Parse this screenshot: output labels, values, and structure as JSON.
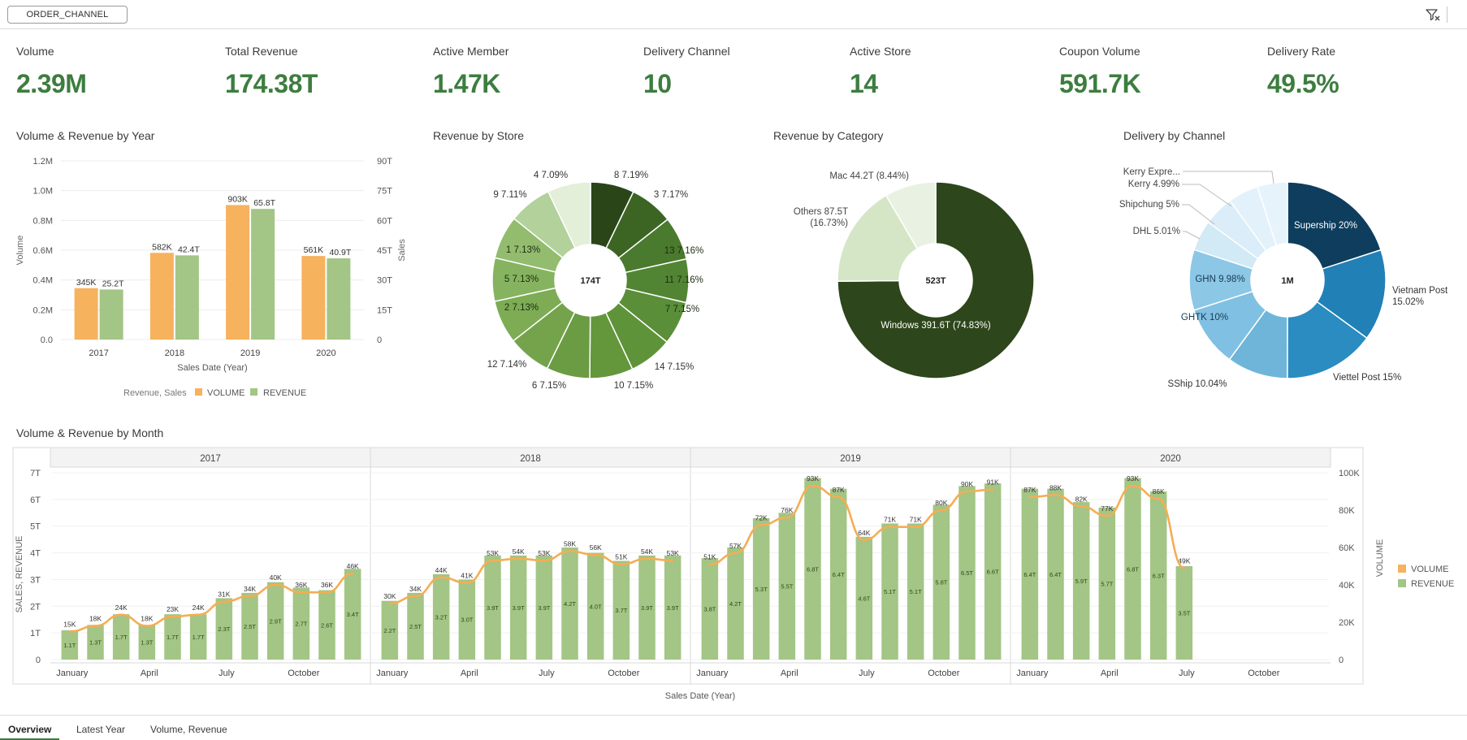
{
  "filter": {
    "label": "ORDER_CHANNEL"
  },
  "toolbar": {
    "filter_icon": "filter-icon"
  },
  "kpis": [
    {
      "label": "Volume",
      "value": "2.39M"
    },
    {
      "label": "Total Revenue",
      "value": "174.38T"
    },
    {
      "label": "Active Member",
      "value": "1.47K"
    },
    {
      "label": "Delivery Channel",
      "value": "10"
    },
    {
      "label": "Active Store",
      "value": "14"
    },
    {
      "label": "Coupon Volume",
      "value": "591.7K"
    },
    {
      "label": "Delivery Rate",
      "value": "49.5%"
    }
  ],
  "titles": {
    "year_chart": "Volume & Revenue by Year",
    "store_chart": "Revenue by Store",
    "category_chart": "Revenue by Category",
    "delivery_chart": "Delivery by Channel",
    "month_chart": "Volume & Revenue by Month"
  },
  "tabs": [
    {
      "label": "Overview",
      "active": true
    },
    {
      "label": "Latest Year",
      "active": false
    },
    {
      "label": "Volume, Revenue",
      "active": false
    }
  ],
  "colors": {
    "volume": "#f6b25d",
    "revenue": "#a3c585",
    "kpi": "#3d7d3f",
    "line": "#f5ad54"
  },
  "chart_data": [
    {
      "id": "year",
      "type": "bar",
      "categories": [
        "2017",
        "2018",
        "2019",
        "2020"
      ],
      "series": [
        {
          "name": "VOLUME",
          "values": [
            345,
            582,
            903,
            561
          ],
          "labels": [
            "345K",
            "582K",
            "903K",
            "561K"
          ]
        },
        {
          "name": "REVENUE",
          "values": [
            25.2,
            42.4,
            65.8,
            40.9
          ],
          "labels": [
            "25.2T",
            "42.4T",
            "65.8T",
            "40.9T"
          ]
        }
      ],
      "y_left_ticks": [
        "1.2M",
        "1.0M",
        "0.8M",
        "0.6M",
        "0.4M",
        "0.2M",
        "0.0"
      ],
      "y_right_ticks": [
        "90T",
        "75T",
        "60T",
        "45T",
        "30T",
        "15T",
        "0"
      ],
      "ylabel": "Volume",
      "y2label": "Sales",
      "xlabel": "Sales Date (Year)",
      "legend_title": "Revenue, Sales",
      "ylim": [
        0,
        1200
      ],
      "y2lim": [
        0,
        90
      ]
    },
    {
      "id": "store",
      "type": "pie",
      "center_label": "174T",
      "slices": [
        {
          "label": "8 7.19%",
          "value": 7.19,
          "color": "#2a4518"
        },
        {
          "label": "3 7.17%",
          "value": 7.17,
          "color": "#3c6524"
        },
        {
          "label": "13 7.16%",
          "value": 7.16,
          "color": "#4a7a2d"
        },
        {
          "label": "11 7.16%",
          "value": 7.16,
          "color": "#528533"
        },
        {
          "label": "7 7.15%",
          "value": 7.15,
          "color": "#5a8e38"
        },
        {
          "label": "14 7.15%",
          "value": 7.15,
          "color": "#5f9339"
        },
        {
          "label": "10 7.15%",
          "value": 7.15,
          "color": "#64963c"
        },
        {
          "label": "6 7.15%",
          "value": 7.15,
          "color": "#6b9c44"
        },
        {
          "label": "12 7.14%",
          "value": 7.14,
          "color": "#74a34c"
        },
        {
          "label": "2 7.13%",
          "value": 7.13,
          "color": "#7dac55"
        },
        {
          "label": "5 7.13%",
          "value": 7.13,
          "color": "#86b35f"
        },
        {
          "label": "1 7.13%",
          "value": 7.13,
          "color": "#93bc6e"
        },
        {
          "label": "9 7.11%",
          "value": 7.11,
          "color": "#b3d19b"
        },
        {
          "label": "4 7.09%",
          "value": 7.09,
          "color": "#e3efd9"
        }
      ]
    },
    {
      "id": "category",
      "type": "pie",
      "center_label": "523T",
      "slices": [
        {
          "label": "Windows 391.6T (74.83%)",
          "value": 74.83,
          "color": "#2d461b"
        },
        {
          "label": "Others 87.5T (16.73%)",
          "value": 16.73,
          "color": "#d5e6c7"
        },
        {
          "label": "Mac 44.2T (8.44%)",
          "value": 8.44,
          "color": "#e9f2e2"
        }
      ]
    },
    {
      "id": "delivery",
      "type": "pie",
      "center_label": "1M",
      "slices": [
        {
          "label": "Supership 20%",
          "value": 20,
          "color": "#0e3d5e"
        },
        {
          "label": "Vietnam Post 15.02%",
          "value": 15.02,
          "color": "#2180b6"
        },
        {
          "label": "Viettel Post 15%",
          "value": 15,
          "color": "#2a8cc0"
        },
        {
          "label": "SShip 10.04%",
          "value": 10.04,
          "color": "#6fb5da"
        },
        {
          "label": "GHTK 10%",
          "value": 10,
          "color": "#80c0e2"
        },
        {
          "label": "GHN 9.98%",
          "value": 9.98,
          "color": "#8cc7e6"
        },
        {
          "label": "DHL 5.01%",
          "value": 5.01,
          "color": "#d2e9f6"
        },
        {
          "label": "Shipchung 5%",
          "value": 5,
          "color": "#daedf8"
        },
        {
          "label": "Kerry 4.99%",
          "value": 4.99,
          "color": "#e2f1fa"
        },
        {
          "label": "Kerry Expre...",
          "value": 4.96,
          "color": "#e7f3fb"
        }
      ]
    },
    {
      "id": "month",
      "type": "bar",
      "years": [
        "2017",
        "2018",
        "2019",
        "2020"
      ],
      "month_ticks": [
        "January",
        "April",
        "July",
        "October"
      ],
      "y_left_ticks": [
        "7T",
        "6T",
        "5T",
        "4T",
        "3T",
        "2T",
        "1T",
        "0"
      ],
      "y_right_ticks": [
        "100K",
        "80K",
        "60K",
        "40K",
        "20K",
        "0"
      ],
      "ylabel": "SALES, REVENUE",
      "y2label": "VOLUME",
      "xlabel": "Sales Date (Year)",
      "legend": [
        "VOLUME",
        "REVENUE"
      ],
      "ylim": [
        0,
        7
      ],
      "y2lim": [
        0,
        100
      ],
      "revenue": [
        [
          1.1,
          1.3,
          1.7,
          1.3,
          1.7,
          1.7,
          2.3,
          2.5,
          2.9,
          2.7,
          2.6,
          3.4
        ],
        [
          2.2,
          2.5,
          3.2,
          3.0,
          3.9,
          3.9,
          3.9,
          4.2,
          4.0,
          3.7,
          3.9,
          3.9
        ],
        [
          3.8,
          4.2,
          5.3,
          5.5,
          6.8,
          6.4,
          4.6,
          5.1,
          5.1,
          5.8,
          6.5,
          6.6
        ],
        [
          6.4,
          6.4,
          5.9,
          5.7,
          6.8,
          6.3,
          3.5
        ]
      ],
      "revenue_labels": [
        [
          "1.1T",
          "1.3T",
          "1.7T",
          "1.3T",
          "1.7T",
          "1.7T",
          "2.3T",
          "2.5T",
          "2.9T",
          "2.7T",
          "2.6T",
          "3.4T"
        ],
        [
          "2.2T",
          "2.5T",
          "3.2T",
          "3.0T",
          "3.9T",
          "3.9T",
          "3.9T",
          "4.2T",
          "4.0T",
          "3.7T",
          "3.9T",
          "3.9T"
        ],
        [
          "3.8T",
          "4.2T",
          "5.3T",
          "5.5T",
          "6.8T",
          "6.4T",
          "4.6T",
          "5.1T",
          "5.1T",
          "5.8T",
          "6.5T",
          "6.6T"
        ],
        [
          "6.4T",
          "6.4T",
          "5.9T",
          "5.7T",
          "6.8T",
          "6.3T",
          "3.5T"
        ]
      ],
      "volume": [
        [
          15,
          18,
          24,
          18,
          23,
          24,
          31,
          34,
          40,
          36,
          36,
          46
        ],
        [
          30,
          34,
          44,
          41,
          53,
          54,
          53,
          58,
          56,
          51,
          54,
          53
        ],
        [
          51,
          57,
          72,
          76,
          93,
          87,
          64,
          71,
          71,
          80,
          90,
          91
        ],
        [
          87,
          88,
          82,
          77,
          93,
          86,
          49
        ]
      ],
      "volume_labels": [
        [
          "15K",
          "18K",
          "24K",
          "18K",
          "23K",
          "24K",
          "31K",
          "34K",
          "40K",
          "36K",
          "36K",
          "46K"
        ],
        [
          "30K",
          "34K",
          "44K",
          "41K",
          "53K",
          "54K",
          "53K",
          "58K",
          "56K",
          "51K",
          "54K",
          "53K"
        ],
        [
          "51K",
          "57K",
          "72K",
          "76K",
          "93K",
          "87K",
          "64K",
          "71K",
          "71K",
          "80K",
          "90K",
          "91K"
        ],
        [
          "87K",
          "88K",
          "82K",
          "77K",
          "93K",
          "86K",
          "49K"
        ]
      ]
    }
  ]
}
